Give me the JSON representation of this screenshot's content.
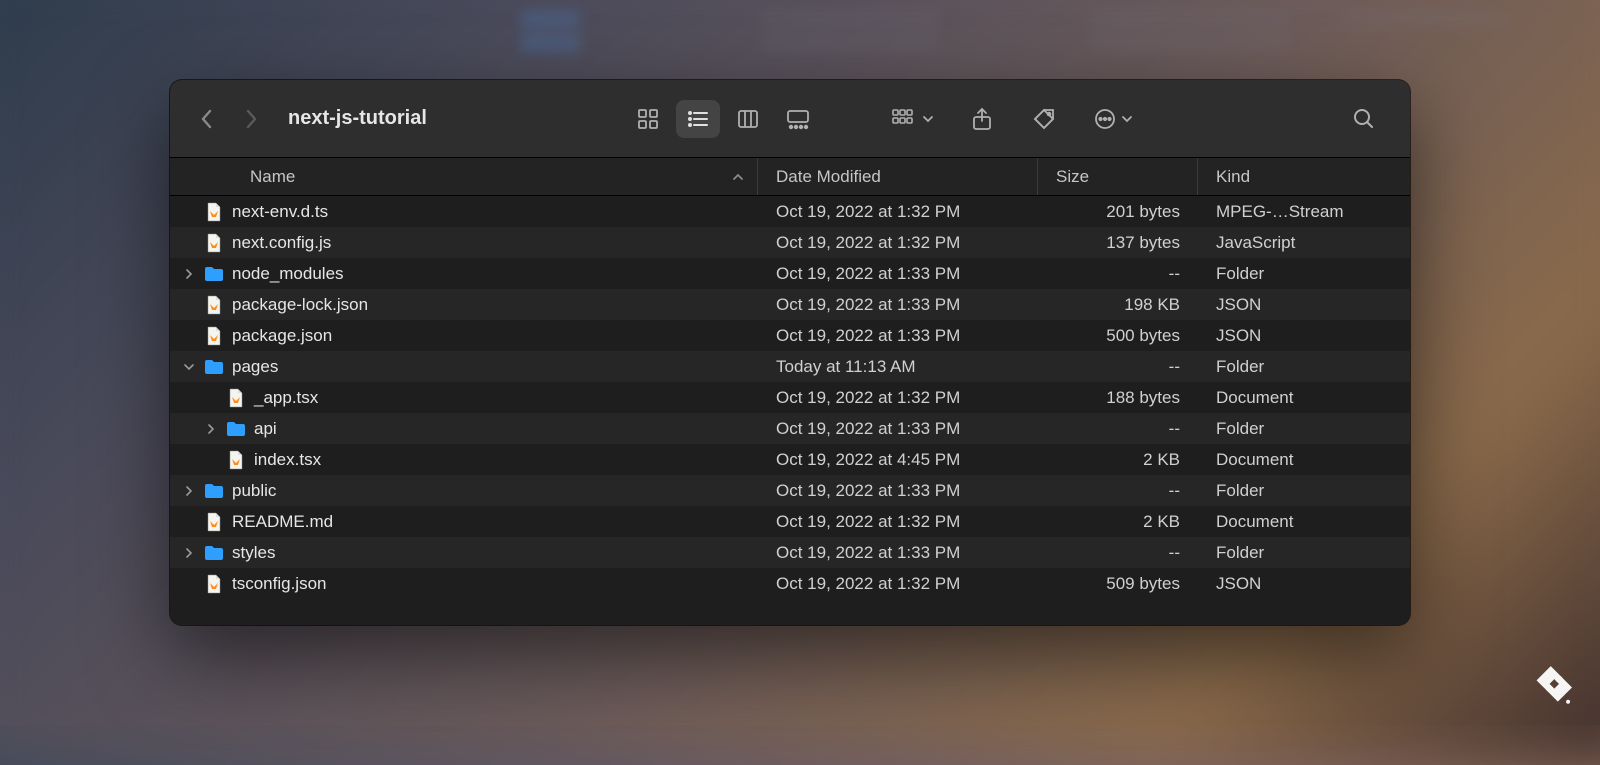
{
  "window": {
    "title": "next-js-tutorial"
  },
  "headers": {
    "name": "Name",
    "date": "Date Modified",
    "size": "Size",
    "kind": "Kind"
  },
  "rows": [
    {
      "indent": 0,
      "icon": "file",
      "disclosure": "",
      "name": "next-env.d.ts",
      "date": "Oct 19, 2022 at 1:32 PM",
      "size": "201 bytes",
      "kind": "MPEG-…Stream"
    },
    {
      "indent": 0,
      "icon": "file",
      "disclosure": "",
      "name": "next.config.js",
      "date": "Oct 19, 2022 at 1:32 PM",
      "size": "137 bytes",
      "kind": "JavaScript"
    },
    {
      "indent": 0,
      "icon": "folder",
      "disclosure": "right",
      "name": "node_modules",
      "date": "Oct 19, 2022 at 1:33 PM",
      "size": "--",
      "kind": "Folder"
    },
    {
      "indent": 0,
      "icon": "file",
      "disclosure": "",
      "name": "package-lock.json",
      "date": "Oct 19, 2022 at 1:33 PM",
      "size": "198 KB",
      "kind": "JSON"
    },
    {
      "indent": 0,
      "icon": "file",
      "disclosure": "",
      "name": "package.json",
      "date": "Oct 19, 2022 at 1:33 PM",
      "size": "500 bytes",
      "kind": "JSON"
    },
    {
      "indent": 0,
      "icon": "folder",
      "disclosure": "down",
      "name": "pages",
      "date": "Today at 11:13 AM",
      "size": "--",
      "kind": "Folder"
    },
    {
      "indent": 1,
      "icon": "file",
      "disclosure": "",
      "name": "_app.tsx",
      "date": "Oct 19, 2022 at 1:32 PM",
      "size": "188 bytes",
      "kind": "Document"
    },
    {
      "indent": 1,
      "icon": "folder",
      "disclosure": "right",
      "name": "api",
      "date": "Oct 19, 2022 at 1:33 PM",
      "size": "--",
      "kind": "Folder"
    },
    {
      "indent": 1,
      "icon": "file",
      "disclosure": "",
      "name": "index.tsx",
      "date": "Oct 19, 2022 at 4:45 PM",
      "size": "2 KB",
      "kind": "Document"
    },
    {
      "indent": 0,
      "icon": "folder",
      "disclosure": "right",
      "name": "public",
      "date": "Oct 19, 2022 at 1:33 PM",
      "size": "--",
      "kind": "Folder"
    },
    {
      "indent": 0,
      "icon": "file",
      "disclosure": "",
      "name": "README.md",
      "date": "Oct 19, 2022 at 1:32 PM",
      "size": "2 KB",
      "kind": "Document"
    },
    {
      "indent": 0,
      "icon": "folder",
      "disclosure": "right",
      "name": "styles",
      "date": "Oct 19, 2022 at 1:33 PM",
      "size": "--",
      "kind": "Folder"
    },
    {
      "indent": 0,
      "icon": "file",
      "disclosure": "",
      "name": "tsconfig.json",
      "date": "Oct 19, 2022 at 1:32 PM",
      "size": "509 bytes",
      "kind": "JSON"
    }
  ]
}
